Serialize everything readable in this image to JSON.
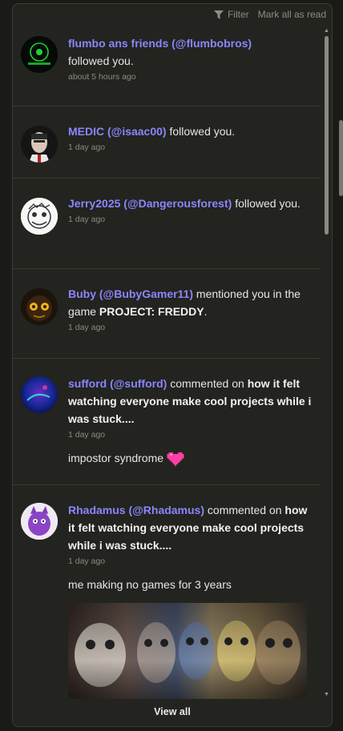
{
  "header": {
    "filter_label": "Filter",
    "filter_icon": "filter-icon",
    "mark_all_label": "Mark all as read"
  },
  "notifications": [
    {
      "user": "flumbo ans friends (@flumbobros)",
      "action": "followed you.",
      "time": "about 5 hours ago"
    },
    {
      "user": "MEDIC (@isaac00)",
      "action": "followed you.",
      "time": "1 day ago"
    },
    {
      "user": "Jerry2025 (@Dangerousforest)",
      "action": "followed you.",
      "time": "1 day ago"
    },
    {
      "user": "Buby (@BubyGamer11)",
      "action": "mentioned you in the game",
      "target": "PROJECT: FREDDY",
      "suffix": ".",
      "time": "1 day ago"
    },
    {
      "user": "sufford (@sufford)",
      "action": "commented on",
      "target": "how it felt watching everyone make cool projects while i was stuck....",
      "time": "1 day ago",
      "comment": "impostor syndrome"
    },
    {
      "user": "Rhadamus (@Rhadamus)",
      "action": "commented on",
      "target": "how it felt watching everyone make cool projects while i was stuck....",
      "time": "1 day ago",
      "comment": "me making no games for 3 years"
    }
  ],
  "footer": {
    "view_all_label": "View all"
  },
  "colors": {
    "username": "#8a86ff",
    "background": "#23231f",
    "heart": "#ff3fa4"
  }
}
